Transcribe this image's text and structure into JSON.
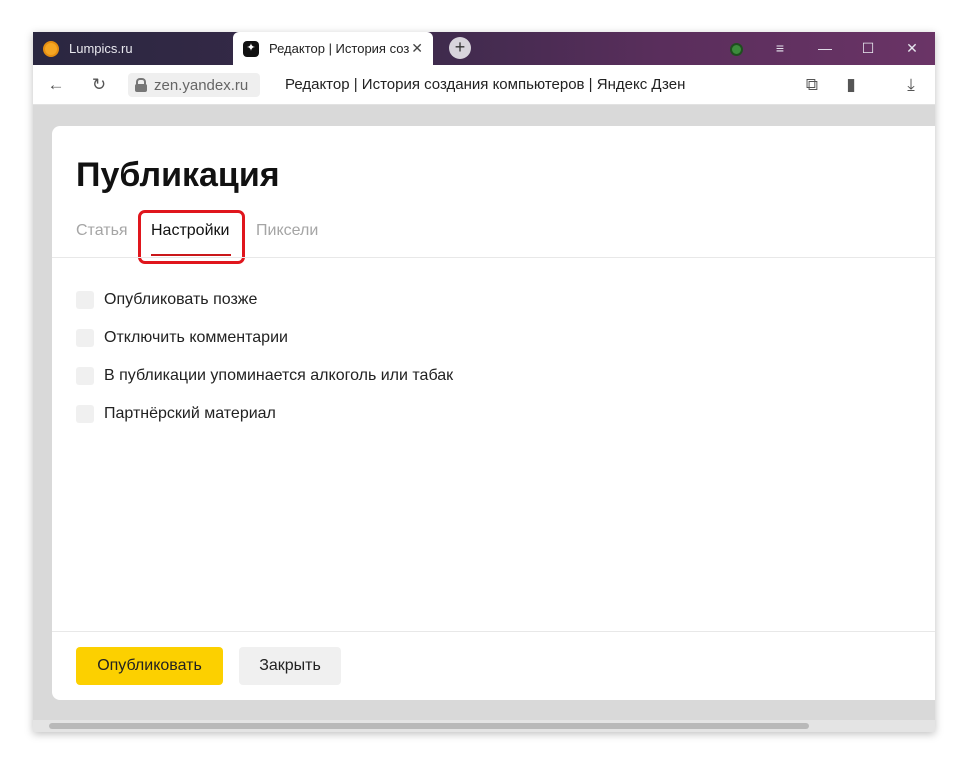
{
  "browser": {
    "tabs": [
      {
        "title": "Lumpics.ru",
        "active": false
      },
      {
        "title": "Редактор | История соз",
        "active": true
      }
    ],
    "new_tab_symbol": "+",
    "close_symbol": "✕",
    "window_controls": {
      "menu": "≡",
      "minimize": "—",
      "maximize": "☐",
      "close": "✕"
    },
    "address": {
      "domain": "zen.yandex.ru",
      "page_title": "Редактор | История создания компьютеров | Яндекс Дзен"
    },
    "nav": {
      "back": "←",
      "reload": "↻",
      "extensions": "⧉",
      "bookmark": "▮",
      "download": "⤓"
    }
  },
  "dialog": {
    "title": "Публикация",
    "tabs": [
      {
        "label": "Статья",
        "active": false
      },
      {
        "label": "Настройки",
        "active": true
      },
      {
        "label": "Пиксели",
        "active": false
      }
    ],
    "options": [
      {
        "label": "Опубликовать позже",
        "checked": false
      },
      {
        "label": "Отключить комментарии",
        "checked": false
      },
      {
        "label": "В публикации упоминается алкоголь или табак",
        "checked": false
      },
      {
        "label": "Партнёрский материал",
        "checked": false
      }
    ],
    "buttons": {
      "publish": "Опубликовать",
      "close": "Закрыть"
    }
  },
  "colors": {
    "accent_button": "#fcd000",
    "highlight": "#e0161d",
    "active_tab_underline": "#c9171a"
  }
}
